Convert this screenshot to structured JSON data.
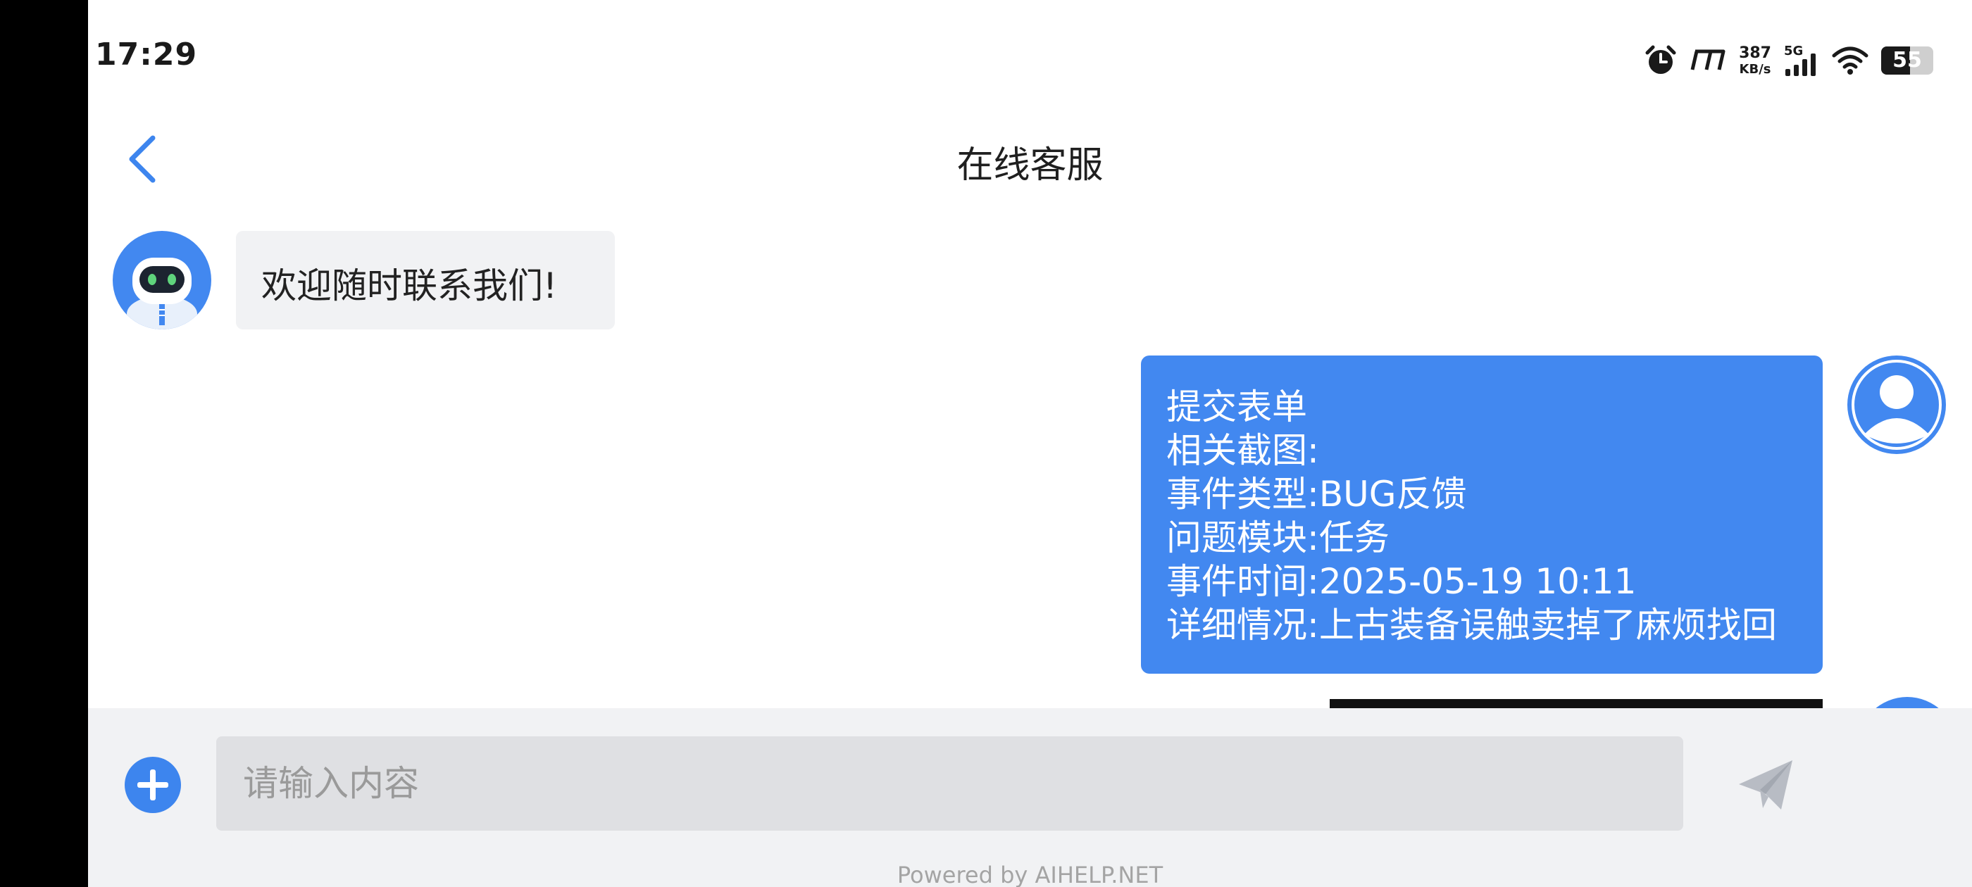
{
  "status_bar": {
    "time": "17:29",
    "net_speed_value": "387",
    "net_speed_unit": "KB/s",
    "network_type": "5G",
    "battery_level": "55",
    "battery_fraction": 0.55,
    "icons": [
      "alarm-icon",
      "mi-icon",
      "signal-icon",
      "wifi-icon",
      "battery-icon"
    ]
  },
  "header": {
    "title": "在线客服",
    "back_icon": "chevron-left-icon"
  },
  "messages": [
    {
      "sender": "bot",
      "avatar_icon": "robot-avatar-icon",
      "text": "欢迎随时联系我们!"
    },
    {
      "sender": "user",
      "avatar_icon": "user-avatar-icon",
      "lines": [
        "提交表单",
        "相关截图:",
        "事件类型:BUG反馈",
        "问题模块:任务",
        "事件时间:2025-05-19 10:11",
        "详细情况:上古装备误触卖掉了麻烦找回"
      ]
    },
    {
      "sender": "user",
      "type": "image"
    }
  ],
  "input_bar": {
    "placeholder": "请输入内容",
    "add_icon": "plus-circle-icon",
    "send_icon": "paper-plane-icon"
  },
  "footer": {
    "powered_by": "Powered by AIHELP.NET"
  },
  "colors": {
    "accent": "#4288f0",
    "bot_bubble": "#f1f2f4",
    "input_bar_bg": "#f1f2f4",
    "input_field_bg": "#dfe0e3"
  }
}
